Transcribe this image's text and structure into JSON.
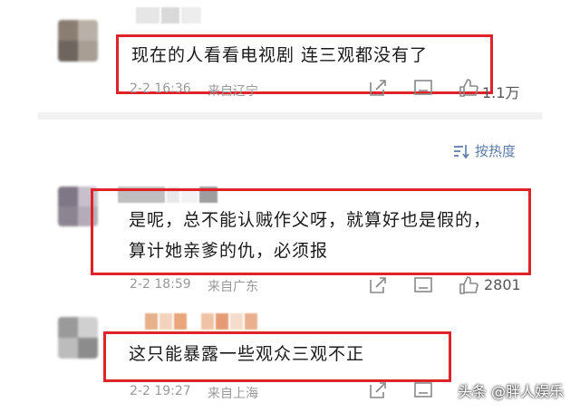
{
  "colors": {
    "highlight": "#e0222b",
    "meta": "#999999",
    "sort": "#5c7ba7"
  },
  "comments": [
    {
      "text": "现在的人看看电视剧 连三观都没有了",
      "time": "2-2 16:36",
      "location": "来自辽宁",
      "likes": "1.1万"
    },
    {
      "text_line1": "是呢，总不能认贼作父呀，就算好也是假的，",
      "text_line2": "算计她亲爹的仇，必须报",
      "time": "2-2 18:59",
      "location": "来自广东",
      "likes": "2801"
    },
    {
      "text": "这只能暴露一些观众三观不正",
      "time": "2-2 19:27",
      "location": "来自上海"
    }
  ],
  "sort": {
    "label": "按热度",
    "icon": "sort-icon"
  },
  "icons": [
    "share-icon",
    "comment-icon",
    "like-icon"
  ],
  "watermark": "头条 @胖人娱乐"
}
